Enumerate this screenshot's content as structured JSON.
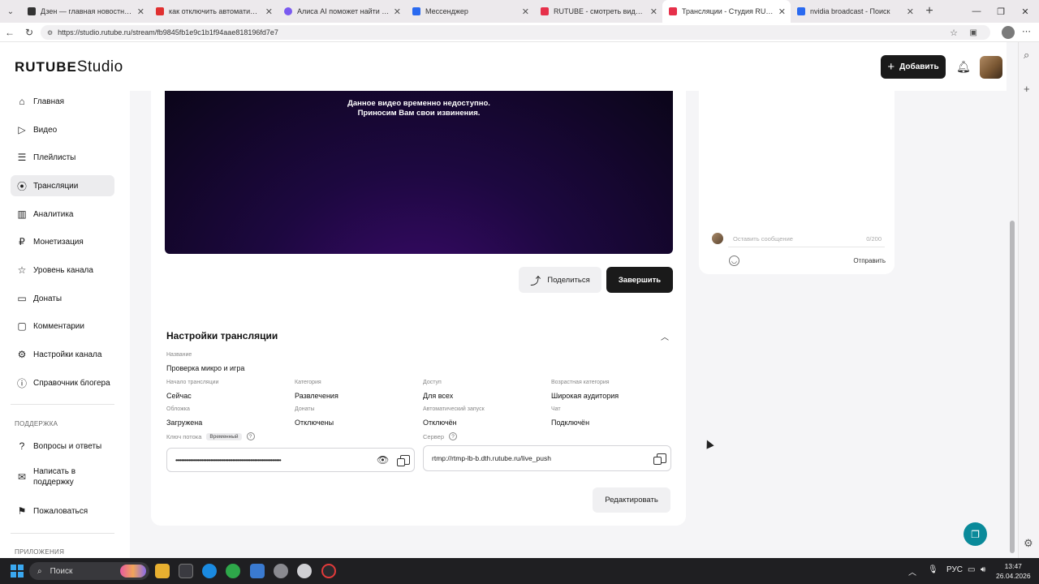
{
  "browser": {
    "tabs": [
      {
        "label": "Дзен — главная новостная инф",
        "color": "#333333"
      },
      {
        "label": "как отключить автоматическое",
        "color": "#e03030"
      },
      {
        "label": "Алиса AI поможет найти ответ",
        "color": "#7a5af0"
      },
      {
        "label": "Мессенджер",
        "color": "#2a6af0"
      },
      {
        "label": "RUTUBE - смотреть видео онлайн",
        "color": "#e6304a"
      },
      {
        "label": "Трансляции - Студия RUTUBE",
        "color": "#e6304a"
      },
      {
        "label": "nvidia broadcast - Поиск",
        "color": "#2a6af0"
      }
    ],
    "url": "https://studio.rutube.ru/stream/fb9845fb1e9c1b1f94aae818196fd7e7"
  },
  "header": {
    "logo_brand": "RUTUBE",
    "logo_product": "Studio",
    "add_label": "Добавить"
  },
  "sidebar": {
    "items": [
      {
        "label": "Главная",
        "icon": "home-icon"
      },
      {
        "label": "Видео",
        "icon": "video-icon"
      },
      {
        "label": "Плейлисты",
        "icon": "playlist-icon"
      },
      {
        "label": "Трансляции",
        "icon": "broadcast-icon",
        "active": true
      },
      {
        "label": "Аналитика",
        "icon": "analytics-icon"
      },
      {
        "label": "Монетизация",
        "icon": "money-icon"
      },
      {
        "label": "Уровень канала",
        "icon": "star-icon"
      },
      {
        "label": "Донаты",
        "icon": "donate-icon"
      },
      {
        "label": "Комментарии",
        "icon": "comments-icon"
      },
      {
        "label": "Настройки канала",
        "icon": "gear-icon"
      },
      {
        "label": "Справочник блогера",
        "icon": "info-icon"
      }
    ],
    "support_title": "ПОДДЕРЖКА",
    "support_items": [
      {
        "label": "Вопросы и ответы",
        "icon": "question-icon"
      },
      {
        "label": "Написать в поддержку",
        "icon": "mail-icon"
      },
      {
        "label": "Пожаловаться",
        "icon": "flag-icon"
      }
    ],
    "apps_title": "ПРИЛОЖЕНИЯ"
  },
  "video": {
    "message_line1": "Данное видео временно недоступно.",
    "message_line2": "Приносим Вам свои извинения.",
    "share_label": "Поделиться",
    "finish_label": "Завершить"
  },
  "chat": {
    "placeholder": "Оставить сообщение",
    "counter": "0/200",
    "send_label": "Отправить"
  },
  "settings": {
    "title": "Настройки трансляции",
    "name_label": "Название",
    "name_value": "Проверка микро и игра",
    "fields": [
      {
        "label": "Начало трансляции",
        "value": "Сейчас"
      },
      {
        "label": "Категория",
        "value": "Развлечения"
      },
      {
        "label": "Доступ",
        "value": "Для всех"
      },
      {
        "label": "Возрастная категория",
        "value": "Широкая аудитория"
      },
      {
        "label": "Обложка",
        "value": "Загружена"
      },
      {
        "label": "Донаты",
        "value": "Отключены"
      },
      {
        "label": "Автоматический запуск",
        "value": "Отключён"
      },
      {
        "label": "Чат",
        "value": "Подключён"
      }
    ],
    "key_label": "Ключ потока",
    "key_badge": "Временный",
    "key_value": "••••••••••••••••••••••••••••••••••••••••••••••••••••••••••••••••••••••••",
    "server_label": "Сервер",
    "server_value": "rtmp://rtmp-lb-b.dth.rutube.ru/live_push",
    "edit_label": "Редактировать"
  },
  "taskbar": {
    "search_label": "Поиск",
    "lang": "РУС",
    "time": "13:47",
    "date": "26.04.2026"
  }
}
